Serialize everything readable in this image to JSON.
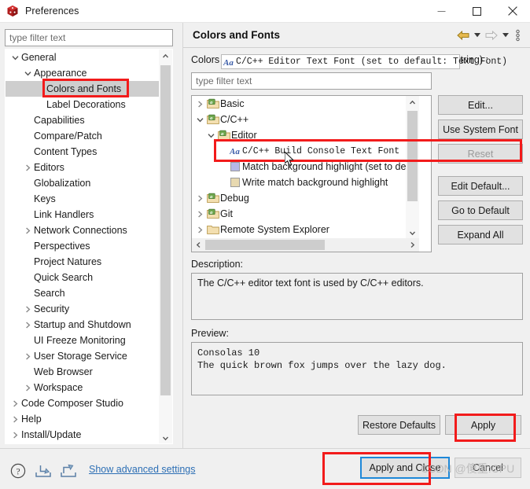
{
  "window": {
    "title": "Preferences",
    "icon": "cube-icon",
    "minimize_label": "—",
    "maximize_label": "□",
    "close_label": "✕"
  },
  "sidebar": {
    "filter_placeholder": "type filter text",
    "filter_value": "",
    "items": [
      {
        "label": "General",
        "level": 1,
        "arrow": "down",
        "selected": false
      },
      {
        "label": "Appearance",
        "level": 2,
        "arrow": "down",
        "selected": false
      },
      {
        "label": "Colors and Fonts",
        "level": 3,
        "arrow": "none",
        "selected": true
      },
      {
        "label": "Label Decorations",
        "level": 3,
        "arrow": "none",
        "selected": false
      },
      {
        "label": "Capabilities",
        "level": 2,
        "arrow": "none",
        "selected": false
      },
      {
        "label": "Compare/Patch",
        "level": 2,
        "arrow": "none",
        "selected": false
      },
      {
        "label": "Content Types",
        "level": 2,
        "arrow": "none",
        "selected": false
      },
      {
        "label": "Editors",
        "level": 2,
        "arrow": "right",
        "selected": false
      },
      {
        "label": "Globalization",
        "level": 2,
        "arrow": "none",
        "selected": false
      },
      {
        "label": "Keys",
        "level": 2,
        "arrow": "none",
        "selected": false
      },
      {
        "label": "Link Handlers",
        "level": 2,
        "arrow": "none",
        "selected": false
      },
      {
        "label": "Network Connections",
        "level": 2,
        "arrow": "right",
        "selected": false
      },
      {
        "label": "Perspectives",
        "level": 2,
        "arrow": "none",
        "selected": false
      },
      {
        "label": "Project Natures",
        "level": 2,
        "arrow": "none",
        "selected": false
      },
      {
        "label": "Quick Search",
        "level": 2,
        "arrow": "none",
        "selected": false
      },
      {
        "label": "Search",
        "level": 2,
        "arrow": "none",
        "selected": false
      },
      {
        "label": "Security",
        "level": 2,
        "arrow": "right",
        "selected": false
      },
      {
        "label": "Startup and Shutdown",
        "level": 2,
        "arrow": "right",
        "selected": false
      },
      {
        "label": "UI Freeze Monitoring",
        "level": 2,
        "arrow": "none",
        "selected": false
      },
      {
        "label": "User Storage Service",
        "level": 2,
        "arrow": "right",
        "selected": false
      },
      {
        "label": "Web Browser",
        "level": 2,
        "arrow": "none",
        "selected": false
      },
      {
        "label": "Workspace",
        "level": 2,
        "arrow": "right",
        "selected": false
      },
      {
        "label": "Code Composer Studio",
        "level": 1,
        "arrow": "right",
        "selected": false
      },
      {
        "label": "Help",
        "level": 1,
        "arrow": "right",
        "selected": false
      },
      {
        "label": "Install/Update",
        "level": 1,
        "arrow": "right",
        "selected": false
      }
    ]
  },
  "page": {
    "title": "Colors and Fonts",
    "description_line": "Colors and Fonts (font, size, type, ? = any character, * = any string) :",
    "filter_placeholder": "type filter text",
    "filter_value": "",
    "nav": {
      "back_icon": "back-arrow-icon",
      "back_caret_icon": "chevron-down-icon",
      "forward_icon": "forward-arrow-icon",
      "forward_caret_icon": "chevron-down-icon",
      "menu_icon": "vertical-dots-icon"
    }
  },
  "font_tree": {
    "rows": [
      {
        "label": "Basic",
        "level": 1,
        "arrow": "right",
        "icon": "folder-font-icon",
        "mono": false
      },
      {
        "label": "C/C++",
        "level": 1,
        "arrow": "down",
        "icon": "folder-font-icon",
        "mono": false
      },
      {
        "label": "Editor",
        "level": 2,
        "arrow": "down",
        "icon": "folder-font-icon",
        "mono": false
      },
      {
        "label": "C/C++ Build Console Text Font (se",
        "level": 3,
        "arrow": "none",
        "icon": "Aa-icon",
        "mono": true
      },
      {
        "label": "Match background highlight (set to def",
        "level": 3,
        "arrow": "none",
        "icon": "swatch-blue-icon",
        "mono": false
      },
      {
        "label": "Write match background highlight",
        "level": 3,
        "arrow": "none",
        "icon": "swatch-tan-icon",
        "mono": false
      },
      {
        "label": "Debug",
        "level": 1,
        "arrow": "right",
        "icon": "folder-font-icon",
        "mono": false
      },
      {
        "label": "Git",
        "level": 1,
        "arrow": "right",
        "icon": "folder-font-icon",
        "mono": false
      },
      {
        "label": "Remote System Explorer",
        "level": 1,
        "arrow": "right",
        "icon": "folder-plain-icon",
        "mono": false
      }
    ],
    "selected_row": {
      "label": "C/C++ Editor Text Font (set to default: Text Font)",
      "icon": "Aa-icon"
    }
  },
  "side_buttons": [
    {
      "label": "Edit...",
      "disabled": false
    },
    {
      "label": "Use System Font",
      "disabled": false
    },
    {
      "label": "Reset",
      "disabled": true
    },
    {
      "label": "Edit Default...",
      "disabled": false
    },
    {
      "label": "Go to Default",
      "disabled": false
    },
    {
      "label": "Expand All",
      "disabled": false
    }
  ],
  "description": {
    "label": "Description:",
    "text": "The C/C++ editor text font is used by C/C++ editors."
  },
  "preview": {
    "label": "Preview:",
    "line1": "Consolas 10",
    "line2": "The quick brown fox jumps over the lazy dog."
  },
  "page_buttons": {
    "restore_defaults": "Restore Defaults",
    "apply": "Apply"
  },
  "footer": {
    "help_icon": "question-mark-icon",
    "import_icon": "import-icon",
    "export_icon": "export-icon",
    "advanced_link": "Show advanced settings",
    "apply_and_close": "Apply and Close",
    "cancel": "Cancel"
  },
  "watermark": "CSDN @傻重:CPU",
  "colors": {
    "annotation_red": "#f21b1b",
    "focus_blue": "#1e88d8",
    "link_blue": "#2d6fb5",
    "selection_gray": "#cecece",
    "window_bg": "#f0f0f0",
    "button_bg": "#e1e1e1"
  }
}
